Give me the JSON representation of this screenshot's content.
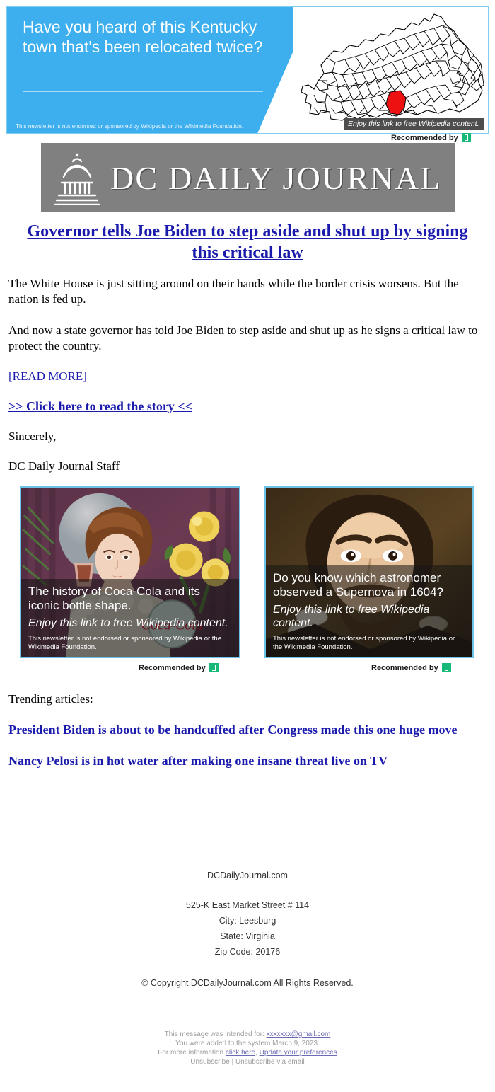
{
  "top_ad": {
    "headline": "Have you heard of this Kentucky town that's been relocated twice?",
    "disclaimer": "This newsletter is not endorsed or sponsored by Wikipedia or the Wikimedia Foundation.",
    "map_caption": "Enjoy this link to free Wikipedia content.",
    "recommended_by": "Recommended by",
    "blue_color": "#3dafee",
    "border_color": "#7fcdee",
    "highlight_county_color": "#ff0000"
  },
  "masthead": {
    "title": "DC DAILY JOURNAL",
    "background_color": "#808080",
    "logo": "capitol-dome-icon"
  },
  "article": {
    "headline": "Governor tells Joe Biden to step aside and shut up by signing this critical law",
    "paragraph_1": "The White House is just sitting around on their hands while the border crisis worsens. But the nation is fed up.",
    "paragraph_2": "And now a state governor has told Joe Biden to step aside and shut up as he signs a critical law to protect the country.",
    "read_more": "[READ MORE]",
    "click_here": ">> Click here to read the story <<",
    "signoff": "Sincerely,",
    "signature": "DC Daily Journal Staff",
    "link_color": "#1a1aad"
  },
  "cards": [
    {
      "title": "The history of Coca-Cola and its iconic bottle shape.",
      "subtitle": "Enjoy this link to free Wikipedia content.",
      "disclaimer": "This newsletter is not endorsed or sponsored by Wikipedia or the Wikimedia Foundation.",
      "recommended_by": "Recommended by",
      "art": "vintage-coca-cola-woman-poster"
    },
    {
      "title": "Do you know which astronomer observed a Supernova in 1604?",
      "subtitle": "Enjoy this link to free Wikipedia content.",
      "disclaimer": "This newsletter is not endorsed or sponsored by Wikipedia or the Wikimedia Foundation.",
      "recommended_by": "Recommended by",
      "art": "johannes-kepler-portrait"
    }
  ],
  "trending": {
    "label": "Trending articles:",
    "items": [
      "President Biden is about to be handcuffed after Congress made this one huge move",
      "Nancy Pelosi is in hot water after making one insane threat live on TV"
    ]
  },
  "footer": {
    "site": "DCDailyJournal.com",
    "street": "525-K East Market Street # 114",
    "city": "City: Leesburg",
    "state": "State: Virginia",
    "zip": "Zip Code: 20176",
    "copyright": "© Copyright DCDailyJournal.com All Rights Reserved."
  },
  "legal": {
    "intended_prefix": "This message was intended for: ",
    "intended_email": "xxxxxxx@gmail.com",
    "added_line": "You were added to the system March 9, 2023.",
    "more_info_prefix": "For more information ",
    "click_here": "click here",
    "separator": ", ",
    "update_prefs": "Update your preferences",
    "unsubscribe_line": "Unsubscribe | Unsubscribe via email"
  }
}
